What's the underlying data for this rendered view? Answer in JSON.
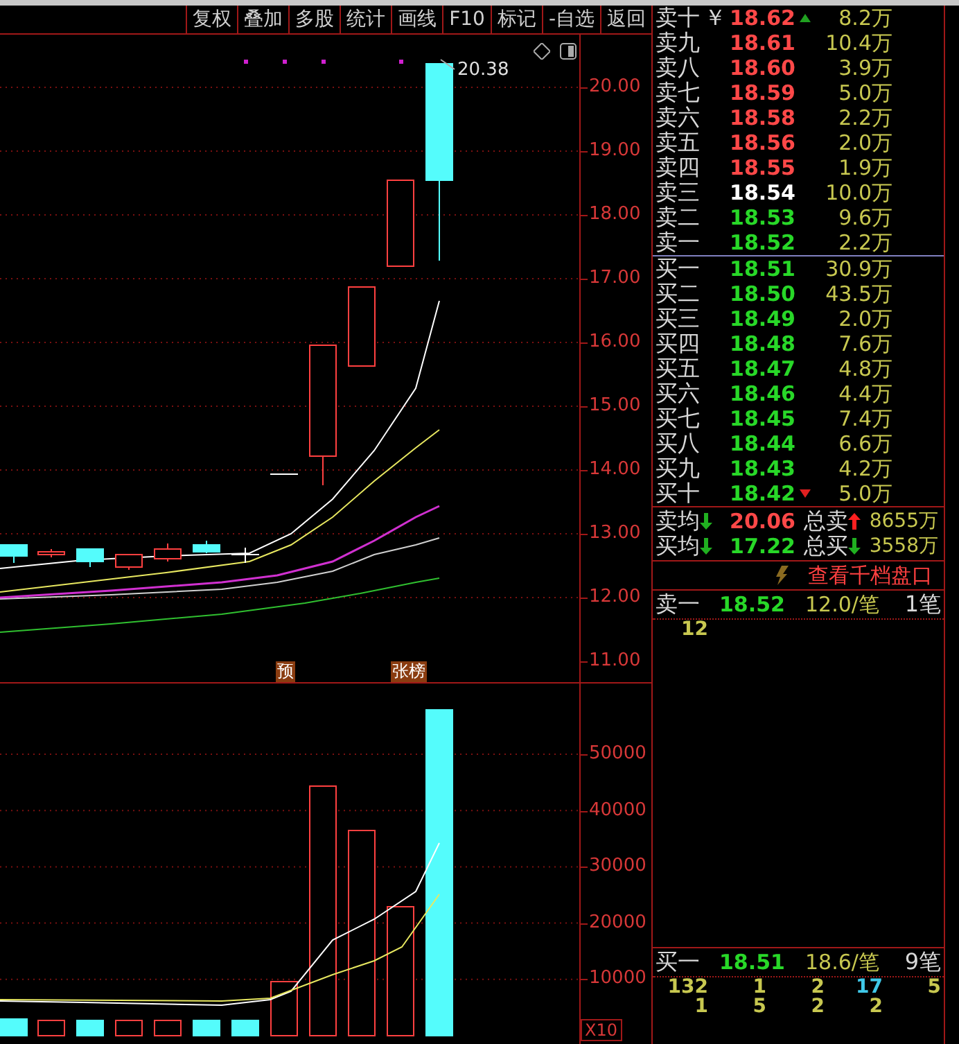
{
  "toolbar": {
    "buttons": [
      "复权",
      "叠加",
      "多股",
      "统计",
      "画线",
      "F10",
      "标记",
      "-自选",
      "返回"
    ]
  },
  "price_chart": {
    "last_price": "20.38",
    "axis_labels": [
      "20.00",
      "19.00",
      "18.00",
      "17.00",
      "16.00",
      "15.00",
      "14.00",
      "13.00",
      "12.00",
      "11.00"
    ],
    "markers": [
      {
        "label": "预"
      },
      {
        "label": "张榜"
      }
    ]
  },
  "volume_chart": {
    "axis_labels": [
      "50000",
      "40000",
      "30000",
      "20000",
      "10000"
    ],
    "multiplier": "X10"
  },
  "order_book": {
    "asks": [
      {
        "label": "卖十",
        "currency": "￥",
        "price": "18.62",
        "color": "#ff4848",
        "arrow": {
          "up": true,
          "color": "#20a020"
        },
        "volume": "8.2万"
      },
      {
        "label": "卖九",
        "price": "18.61",
        "color": "#ff4848",
        "volume": "10.4万"
      },
      {
        "label": "卖八",
        "price": "18.60",
        "color": "#ff4848",
        "volume": "3.9万"
      },
      {
        "label": "卖七",
        "price": "18.59",
        "color": "#ff4848",
        "volume": "5.0万"
      },
      {
        "label": "卖六",
        "price": "18.58",
        "color": "#ff4848",
        "volume": "2.2万"
      },
      {
        "label": "卖五",
        "price": "18.56",
        "color": "#ff4848",
        "volume": "2.0万"
      },
      {
        "label": "卖四",
        "price": "18.55",
        "color": "#ff4848",
        "volume": "1.9万"
      },
      {
        "label": "卖三",
        "price": "18.54",
        "color": "#ffffff",
        "volume": "10.0万"
      },
      {
        "label": "卖二",
        "price": "18.53",
        "color": "#28d828",
        "volume": "9.6万"
      },
      {
        "label": "卖一",
        "price": "18.52",
        "color": "#28d828",
        "volume": "2.2万"
      }
    ],
    "bids": [
      {
        "label": "买一",
        "price": "18.51",
        "color": "#28d828",
        "volume": "30.9万"
      },
      {
        "label": "买二",
        "price": "18.50",
        "color": "#28d828",
        "volume": "43.5万"
      },
      {
        "label": "买三",
        "price": "18.49",
        "color": "#28d828",
        "volume": "2.0万"
      },
      {
        "label": "买四",
        "price": "18.48",
        "color": "#28d828",
        "volume": "7.6万"
      },
      {
        "label": "买五",
        "price": "18.47",
        "color": "#28d828",
        "volume": "4.8万"
      },
      {
        "label": "买六",
        "price": "18.46",
        "color": "#28d828",
        "volume": "4.4万"
      },
      {
        "label": "买七",
        "price": "18.45",
        "color": "#28d828",
        "volume": "7.4万"
      },
      {
        "label": "买八",
        "price": "18.44",
        "color": "#28d828",
        "volume": "6.6万"
      },
      {
        "label": "买九",
        "price": "18.43",
        "color": "#28d828",
        "volume": "4.2万"
      },
      {
        "label": "买十",
        "price": "18.42",
        "color": "#28d828",
        "arrow": {
          "up": false,
          "color": "#e02020"
        },
        "volume": "5.0万"
      }
    ]
  },
  "summary": [
    {
      "label": "卖均",
      "label_arrow": {
        "up": false,
        "color": "#20b020"
      },
      "price": "20.06",
      "color": "#ff4848",
      "total_label": "总卖",
      "total_arrow": {
        "up": true,
        "color": "#ff2020"
      },
      "total": "8655万"
    },
    {
      "label": "买均",
      "label_arrow": {
        "up": false,
        "color": "#20b020"
      },
      "price": "17.22",
      "color": "#28d828",
      "total_label": "总买",
      "total_arrow": {
        "up": false,
        "color": "#20b020"
      },
      "total": "3558万"
    }
  ],
  "depth_link": {
    "label": "查看千档盘口"
  },
  "ask_queue": {
    "label": "卖一",
    "price": "18.52",
    "per_order": "12.0/笔",
    "orders": "1笔",
    "queue": [
      {
        "value": "12",
        "color": "#c8c850"
      }
    ]
  },
  "bid_queue": {
    "label": "买一",
    "price": "18.51",
    "per_order": "18.6/笔",
    "orders": "9笔",
    "queue": [
      {
        "value": "132",
        "color": "#c8c850"
      },
      {
        "value": "1",
        "color": "#c8c850"
      },
      {
        "value": "2",
        "color": "#c8c850"
      },
      {
        "value": "17",
        "color": "#40c8e8"
      },
      {
        "value": "5",
        "color": "#c8c850"
      },
      {
        "value": "1",
        "color": "#c8c850"
      },
      {
        "value": "5",
        "color": "#c8c850"
      },
      {
        "value": "2",
        "color": "#c8c850"
      },
      {
        "value": "2",
        "color": "#c8c850"
      }
    ]
  }
}
